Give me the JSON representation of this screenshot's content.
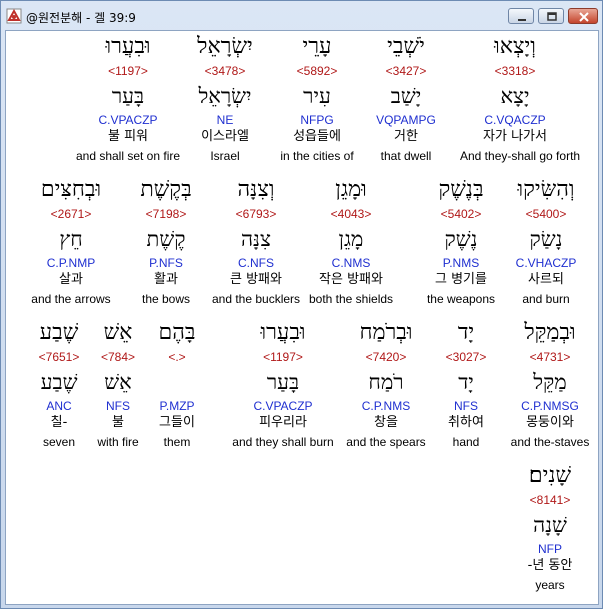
{
  "window": {
    "title": "@원전분해 - 겔 39:9"
  },
  "rows": [
    {
      "words": [
        {
          "hebrew": "וּבִעֲרוּ",
          "strong": "<1197>",
          "lemma": "בָּעַר",
          "morph": "C.VPACZP",
          "korean": "불 피워",
          "english": "and shall set on fire"
        },
        {
          "hebrew": "יִשְׂרָאֵל",
          "strong": "<3478>",
          "lemma": "יִשְׂרָאֵל",
          "morph": "NE",
          "korean": "이스라엘",
          "english": "Israel"
        },
        {
          "hebrew": "עָרֵי",
          "strong": "<5892>",
          "lemma": "עִיר",
          "morph": "NFPG",
          "korean": "성읍들에",
          "english": "in the cities of"
        },
        {
          "hebrew": "יֹשְׁבֵי",
          "strong": "<3427>",
          "lemma": "יָשַׁב",
          "morph": "VQPAMPG",
          "korean": "거한",
          "english": "that dwell"
        },
        {
          "hebrew": "וְיָצְאוּ",
          "strong": "<3318>",
          "lemma": "יָצָא",
          "morph": "C.VQACZP",
          "korean": "자가 나가서",
          "english": "And they-shall go forth"
        }
      ]
    },
    {
      "words": [
        {
          "hebrew": "וּבְחִצִּים",
          "strong": "<2671>",
          "lemma": "חֵץ",
          "morph": "C.P.NMP",
          "korean": "살과",
          "english": "and the arrows"
        },
        {
          "hebrew": "בְּקֶשֶׁת",
          "strong": "<7198>",
          "lemma": "קֶשֶׁת",
          "morph": "P.NFS",
          "korean": "활과",
          "english": "the bows"
        },
        {
          "hebrew": "וְצִנָּה",
          "strong": "<6793>",
          "lemma": "צִנָּה",
          "morph": "C.NFS",
          "korean": "큰 방패와",
          "english": "and the bucklers"
        },
        {
          "hebrew": "וּמָגֵן",
          "strong": "<4043>",
          "lemma": "מָגֵן",
          "morph": "C.NMS",
          "korean": "작은 방패와",
          "english": "both the shields"
        },
        {
          "hebrew": "בְּנֶשֶׁק",
          "strong": "<5402>",
          "lemma": "נֶשֶׁק",
          "morph": "P.NMS",
          "korean": "그 병기를",
          "english": "the weapons"
        },
        {
          "hebrew": "וְהִשִּׂיקוּ",
          "strong": "<5400>",
          "lemma": "נָשַׂק",
          "morph": "C.VHACZP",
          "korean": "사르되",
          "english": "and burn"
        }
      ]
    },
    {
      "words": [
        {
          "hebrew": "שֶׁבַע",
          "strong": "<7651>",
          "lemma": "שֶׁבַע",
          "morph": "ANC",
          "korean": "칠-",
          "english": "seven"
        },
        {
          "hebrew": "אֵשׁ",
          "strong": "<784>",
          "lemma": "אֵשׁ",
          "morph": "NFS",
          "korean": "불",
          "english": "with fire"
        },
        {
          "hebrew": "בָּהֶם",
          "strong": "<.>",
          "lemma": "",
          "morph": "P.MZP",
          "korean": "그들이",
          "english": "them"
        },
        {
          "hebrew": "וּבִעֲרוּ",
          "strong": "<1197>",
          "lemma": "בָּעַר",
          "morph": "C.VPACZP",
          "korean": "피우리라",
          "english": "and they shall burn"
        },
        {
          "hebrew": "וּבְרֹמַח",
          "strong": "<7420>",
          "lemma": "רֹמַח",
          "morph": "C.P.NMS",
          "korean": "창을",
          "english": "and the spears"
        },
        {
          "hebrew": "יָד",
          "strong": "<3027>",
          "lemma": "יָד",
          "morph": "NFS",
          "korean": "취하여",
          "english": "hand"
        },
        {
          "hebrew": "וּבְמַקֵּל",
          "strong": "<4731>",
          "lemma": "מַקֵּל",
          "morph": "C.P.NMSG",
          "korean": "몽둥이와",
          "english": "and the-staves"
        }
      ]
    },
    {
      "words": [
        {
          "hebrew": "שָׁנִים׃",
          "strong": "<8141>",
          "lemma": "שָׁנָה",
          "morph": "NFP",
          "korean": "-년 동안",
          "english": "years"
        }
      ]
    }
  ]
}
